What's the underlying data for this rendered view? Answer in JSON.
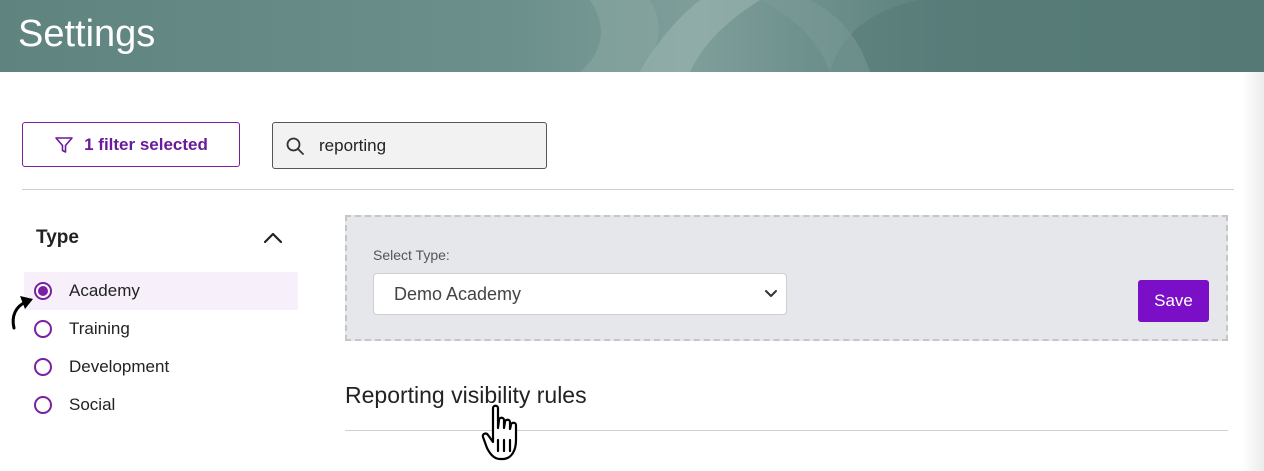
{
  "header": {
    "title": "Settings"
  },
  "toolbar": {
    "filter_label": "1 filter selected",
    "search_value": "reporting"
  },
  "type_filter": {
    "title": "Type",
    "options": [
      {
        "label": "Academy",
        "selected": true
      },
      {
        "label": "Training",
        "selected": false
      },
      {
        "label": "Development",
        "selected": false
      },
      {
        "label": "Social",
        "selected": false
      }
    ]
  },
  "panel": {
    "select_label": "Select Type:",
    "select_value": "Demo Academy",
    "save_label": "Save"
  },
  "section": {
    "title": "Reporting visibility rules"
  },
  "colors": {
    "accent": "#7b1fa2",
    "save_button": "#7b0ec7",
    "header_bg": "#5f8480"
  },
  "icons": [
    "filter-icon",
    "search-icon",
    "chevron-up-icon",
    "chevron-down-icon",
    "arrow-cursor-icon",
    "hand-cursor-icon"
  ]
}
